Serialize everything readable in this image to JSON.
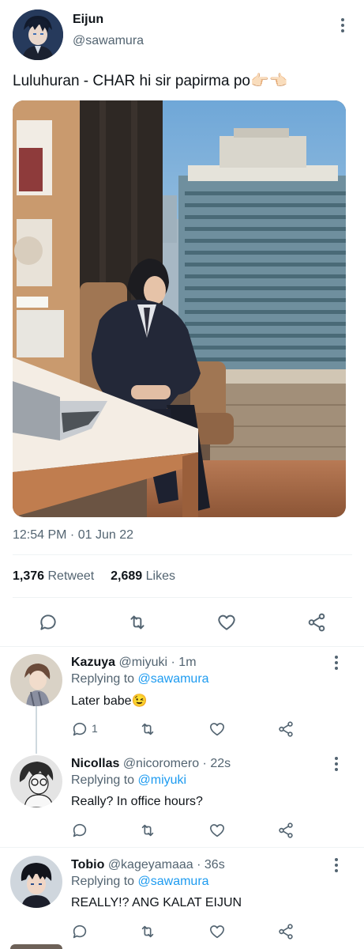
{
  "tweet": {
    "author_name": "Eijun",
    "author_handle": "@sawamura",
    "text": "Luluhuran - CHAR  hi sir papirma po👉🏻👈🏻",
    "timestamp": "12:54 PM · 01 Jun 22",
    "retweet_count": "1,376",
    "retweet_label": "Retweet",
    "likes_count": "2,689",
    "likes_label": "Likes",
    "icons": [
      "comment-icon",
      "retweet-icon",
      "heart-icon",
      "share-icon"
    ]
  },
  "replies": [
    {
      "name": "Kazuya",
      "handle": "@miyuki",
      "time": "· 1m",
      "replying_prefix": "Replying to",
      "replying_to": "@sawamura",
      "text": "Later babe😉",
      "reply_count": "1"
    },
    {
      "name": "Nicollas",
      "handle": "@nicoromero",
      "time": "· 22s",
      "replying_prefix": "Replying to",
      "replying_to": "@miyuki",
      "text": "Really? In office hours?",
      "reply_count": ""
    },
    {
      "name": "Tobio",
      "handle": "@kageyamaaa",
      "time": "· 36s",
      "replying_prefix": "Replying to",
      "replying_to": "@sawamura",
      "text": "REALLY!? ANG KALAT EIJUN",
      "reply_count": ""
    }
  ],
  "colors": {
    "link": "#1d9bf0",
    "muted": "#536471",
    "divider": "#eff3f4"
  }
}
